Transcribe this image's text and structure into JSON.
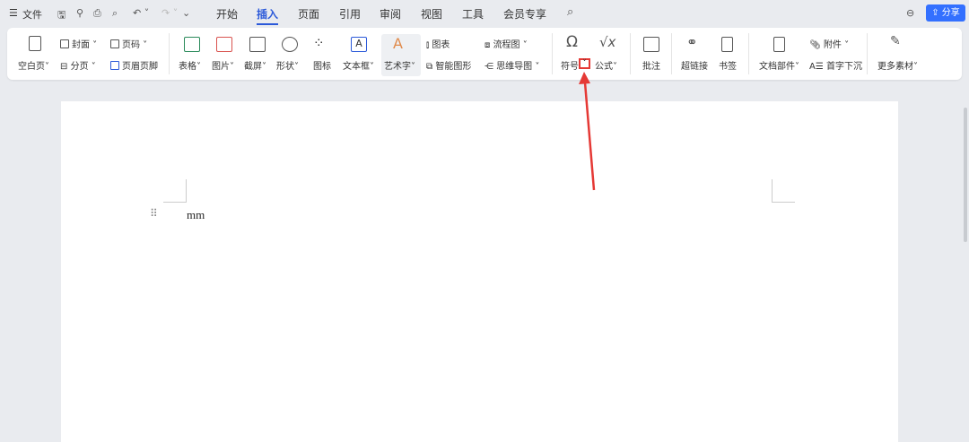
{
  "titlebar": {
    "menu_icon": "hamburger-icon",
    "file": "文件",
    "tabs": [
      "开始",
      "插入",
      "页面",
      "引用",
      "审阅",
      "视图",
      "工具",
      "会员专享"
    ],
    "active_tab": "插入",
    "share": "分享"
  },
  "ribbon": {
    "blank_page": "空白页",
    "cover": "封面",
    "page_break": "分页",
    "page_number": "页码",
    "header_footer": "页眉页脚",
    "table": "表格",
    "picture": "图片",
    "screenshot": "截屏",
    "shape": "形状",
    "icon": "图标",
    "textbox": "文本框",
    "wordart": "艺术字",
    "chart": "图表",
    "smartart": "智能图形",
    "flowchart": "流程图",
    "mindmap": "思维导图",
    "symbol": "符号",
    "formula": "公式",
    "comment": "批注",
    "hyperlink": "超链接",
    "bookmark": "书签",
    "doc_parts": "文档部件",
    "attachment": "附件",
    "drop_cap": "首字下沉",
    "more_materials": "更多素材"
  },
  "document": {
    "text": "mm"
  },
  "colors": {
    "accent": "#2b59d9",
    "share": "#3370ff",
    "annotation": "#e53935"
  }
}
